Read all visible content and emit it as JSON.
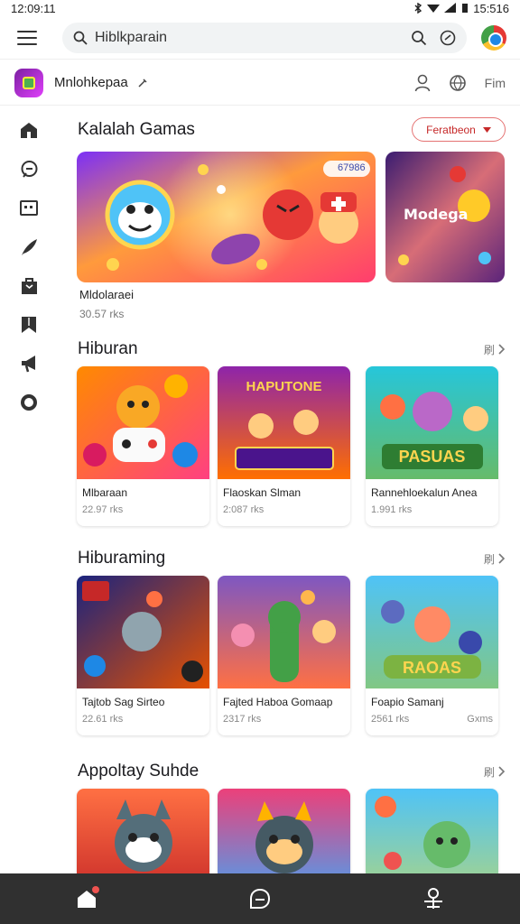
{
  "status": {
    "time": "12:09:11",
    "right_time": "15:516",
    "icons": [
      "bluetooth-icon",
      "wifi-icon",
      "signal-icon",
      "battery-icon"
    ]
  },
  "search": {
    "value": "Hiblkparain"
  },
  "app": {
    "name": "Mnlohkepaa",
    "right_text": "Fim"
  },
  "sidebar": {
    "items": [
      "home-icon",
      "chat-icon",
      "tv-icon",
      "feather-icon",
      "bag-icon",
      "bookmark-icon",
      "megaphone-icon",
      "circle-icon"
    ]
  },
  "featured": {
    "title": "Kalalah Gamas",
    "filter_label": "Feratbeon",
    "banner_badge": "67986",
    "side_banner_text": "Modega",
    "item_title": "Mldolaraei",
    "item_meta": "30.57 rks"
  },
  "sections": [
    {
      "title": "Hiburan",
      "more": "刷",
      "cards": [
        {
          "title": "Mlbaraan",
          "meta": "22.97 rks",
          "tag": "",
          "art": ""
        },
        {
          "title": "Flaoskan Slman",
          "meta": "2:087 rks",
          "tag": "",
          "art": "HAPUTONE"
        },
        {
          "title": "Rannehloekalun Anea",
          "meta": "1.991 rks",
          "tag": "",
          "art": "PASUAS"
        }
      ]
    },
    {
      "title": "Hiburaming",
      "more": "刷",
      "cards": [
        {
          "title": "Tajtob Sag Sirteo",
          "meta": "22.61 rks",
          "tag": "",
          "art": ""
        },
        {
          "title": "Fajted Haboa Gomaap",
          "meta": "2317 rks",
          "tag": "",
          "art": ""
        },
        {
          "title": "Foapio Samanj",
          "meta": "2561 rks",
          "tag": "Gxms",
          "art": "RAOAS"
        }
      ]
    },
    {
      "title": "Appoltay Suhde",
      "more": "刷",
      "cards": [
        {
          "title": "",
          "meta": "",
          "tag": "",
          "art": ""
        },
        {
          "title": "",
          "meta": "",
          "tag": "",
          "art": ""
        },
        {
          "title": "",
          "meta": "",
          "tag": "",
          "art": ""
        }
      ]
    }
  ],
  "colors": {
    "accent": "#c62828",
    "bottom_bar": "#303030"
  }
}
